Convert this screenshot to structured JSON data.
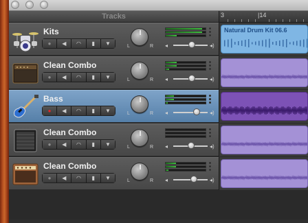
{
  "window": {
    "header_title": "Tracks"
  },
  "ruler": {
    "markers": [
      "3",
      "|14"
    ]
  },
  "tracks": [
    {
      "name": "Kits",
      "icon": "drum-kit-icon",
      "record_armed": false,
      "volume": 0.55,
      "meter": 0.92,
      "region": {
        "kind": "midi",
        "label": "Natural Drum Kit 06.6"
      }
    },
    {
      "name": "Clean Combo",
      "icon": "guitar-amp-icon",
      "record_armed": false,
      "volume": 0.55,
      "meter": 0.28,
      "region": {
        "kind": "audio",
        "label": ""
      }
    },
    {
      "name": "Bass",
      "icon": "bass-guitar-icon",
      "record_armed": true,
      "volume": 0.72,
      "meter": 0.2,
      "selected": true,
      "region": {
        "kind": "audio-selected",
        "label": ""
      }
    },
    {
      "name": "Clean Combo",
      "icon": "speaker-cabinet-icon",
      "record_armed": false,
      "volume": 0.52,
      "meter": 0.0,
      "region": {
        "kind": "audio",
        "label": ""
      }
    },
    {
      "name": "Clean Combo",
      "icon": "vintage-amp-icon",
      "record_armed": false,
      "volume": 0.62,
      "meter": 0.25,
      "region": {
        "kind": "audio",
        "label": ""
      }
    }
  ],
  "controls": {
    "pan_left": "L",
    "pan_right": "R",
    "buttons": [
      "record-button",
      "mute-button",
      "solo-button",
      "lock-button",
      "expand-button"
    ]
  },
  "colors": {
    "selected_track": "#6a92bb",
    "midi_region": "#7fb6e4",
    "audio_region": "#a491d6",
    "record": "#e1282a"
  }
}
